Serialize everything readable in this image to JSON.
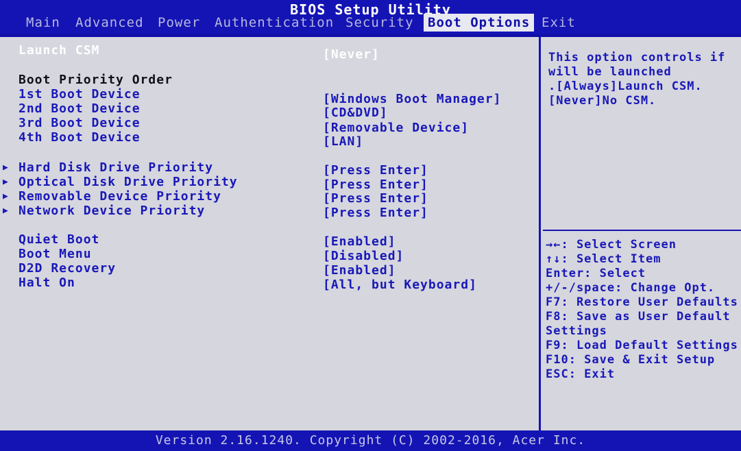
{
  "window": {
    "title": "BIOS Setup Utility"
  },
  "tabs": [
    {
      "label": "Main"
    },
    {
      "label": "Advanced"
    },
    {
      "label": "Power"
    },
    {
      "label": "Authentication"
    },
    {
      "label": "Security"
    },
    {
      "label": "Boot Options",
      "active": true
    },
    {
      "label": "Exit"
    }
  ],
  "settings": {
    "launch_csm": {
      "label": "Launch CSM",
      "value": "[Never]"
    },
    "boot_priority_heading": "Boot Priority Order",
    "boot_devices": [
      {
        "label": "1st Boot Device",
        "value": "[Windows Boot Manager]"
      },
      {
        "label": "2nd Boot Device",
        "value": "[CD&DVD]"
      },
      {
        "label": "3rd Boot Device",
        "value": "[Removable Device]"
      },
      {
        "label": "4th Boot Device",
        "value": "[LAN]"
      }
    ],
    "submenus": [
      {
        "label": "Hard Disk Drive Priority",
        "value": "[Press Enter]"
      },
      {
        "label": "Optical Disk Drive Priority",
        "value": "[Press Enter]"
      },
      {
        "label": "Removable Device Priority",
        "value": "[Press Enter]"
      },
      {
        "label": "Network Device Priority",
        "value": "[Press Enter]"
      }
    ],
    "options": [
      {
        "label": "Quiet Boot",
        "value": "[Enabled]"
      },
      {
        "label": "Boot Menu",
        "value": "[Disabled]"
      },
      {
        "label": "D2D Recovery",
        "value": "[Enabled]"
      },
      {
        "label": "Halt On",
        "value": "[All, but Keyboard]"
      }
    ]
  },
  "help": {
    "lines": [
      "This option controls if",
      "will be launched",
      ".[Always]Launch CSM.",
      "[Never]No CSM."
    ]
  },
  "keys": [
    "→←: Select Screen",
    "↑↓: Select Item",
    "Enter: Select",
    "+/-/space: Change Opt.",
    "F7: Restore User Defaults",
    "F8: Save as User Default",
    "Settings",
    "F9: Load Default Settings",
    "F10: Save & Exit Setup",
    "ESC: Exit"
  ],
  "footer": {
    "text": "Version 2.16.1240. Copyright (C) 2002-2016, Acer Inc."
  },
  "icons": {
    "submenu_arrow": "triangle-right-icon"
  },
  "colors": {
    "background": "#1010a8",
    "panel": "#d6d6de",
    "text": "#1818b8",
    "selected": "#ffffff"
  }
}
